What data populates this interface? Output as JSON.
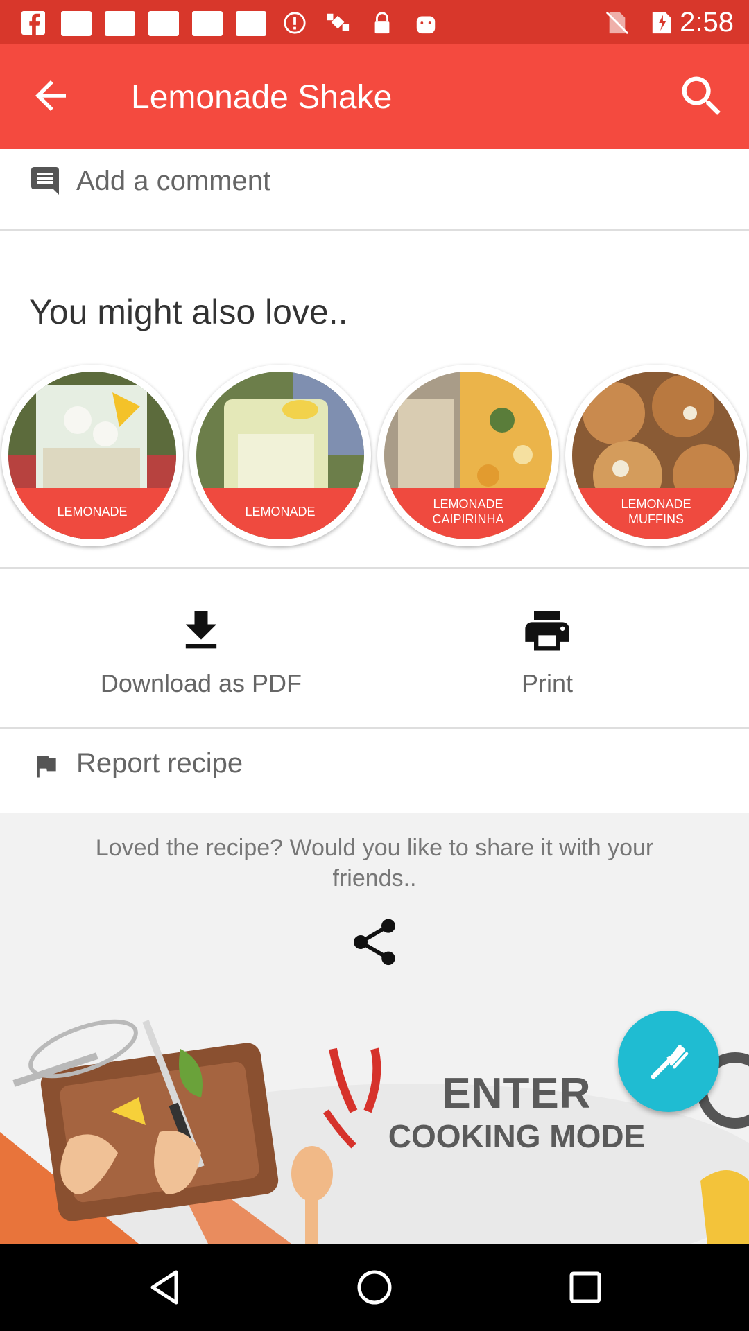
{
  "status_bar": {
    "time": "2:58",
    "icons": [
      "facebook-icon",
      "notification-icon",
      "notification-icon",
      "notification-icon",
      "notification-icon",
      "notification-icon",
      "alert-icon",
      "satellite-icon",
      "lock-icon",
      "android-icon",
      "no-sim-icon",
      "signal-icon",
      "battery-icon"
    ]
  },
  "app_bar": {
    "title": "Lemonade Shake",
    "back_icon": "arrow-back-icon",
    "search_icon": "search-icon",
    "color": "#f44a3f"
  },
  "comment": {
    "placeholder": "Add a comment",
    "icon": "comment-icon"
  },
  "recommendations": {
    "title": "You might also love..",
    "items": [
      {
        "label": "LEMONADE"
      },
      {
        "label": "LEMONADE"
      },
      {
        "label": "LEMONADE\nCAIPIRINHA"
      },
      {
        "label": "LEMONADE\nMUFFINS"
      }
    ]
  },
  "actions": {
    "download_label": "Download as PDF",
    "print_label": "Print"
  },
  "report": {
    "label": "Report recipe",
    "icon": "flag-icon"
  },
  "share": {
    "text": "Loved the recipe? Would you like to share it with your friends..",
    "icon": "share-icon"
  },
  "cooking_mode": {
    "line1": "ENTER",
    "line2": "COOKING MODE"
  },
  "fab": {
    "icon": "fork-icon",
    "color": "#1fbcd2"
  },
  "nav_bar": {
    "back": "nav-back-icon",
    "home": "nav-home-icon",
    "recents": "nav-recents-icon"
  }
}
